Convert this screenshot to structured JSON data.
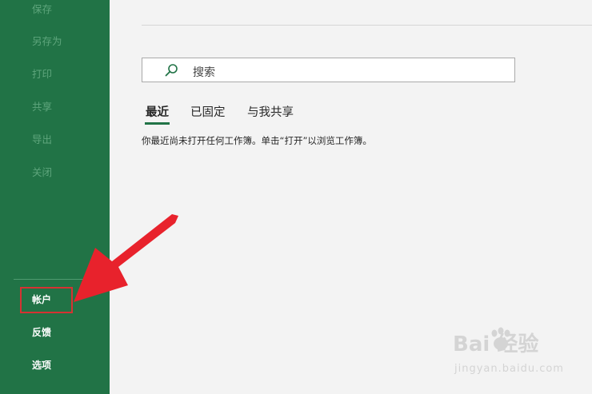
{
  "sidebar": {
    "items": [
      {
        "label": "保存"
      },
      {
        "label": "另存为"
      },
      {
        "label": "打印"
      },
      {
        "label": "共享"
      },
      {
        "label": "导出"
      },
      {
        "label": "关闭"
      }
    ],
    "bottom_items": [
      {
        "label": "帐户"
      },
      {
        "label": "反馈"
      },
      {
        "label": "选项"
      }
    ]
  },
  "search": {
    "placeholder": "搜索"
  },
  "tabs": [
    {
      "label": "最近"
    },
    {
      "label": "已固定"
    },
    {
      "label": "与我共享"
    }
  ],
  "empty_message": "你最近尚未打开任何工作簿。单击“打开”以浏览工作簿。",
  "watermark": {
    "main": "Bai 经验",
    "sub": "jingyan.baidu.com"
  },
  "colors": {
    "sidebar_bg": "#217346",
    "annotation_red": "#e8222c"
  }
}
